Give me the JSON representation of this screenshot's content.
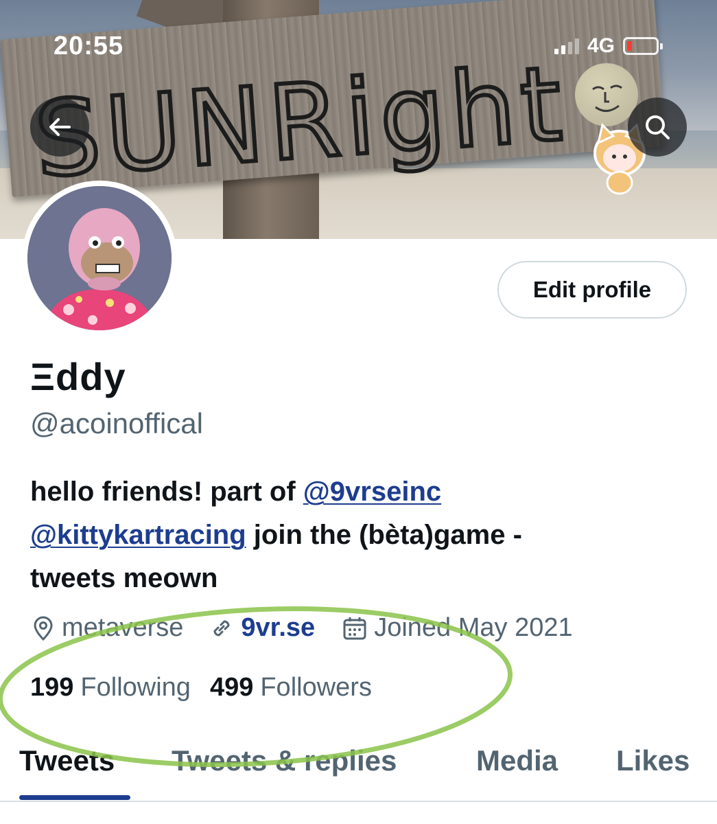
{
  "status_bar": {
    "time": "20:55",
    "network": "4G",
    "battery_color": "#ff3b30"
  },
  "banner": {
    "sign_text": "SUNRight"
  },
  "header": {
    "back_icon": "arrow-left-icon",
    "search_icon": "search-icon"
  },
  "profile": {
    "edit_label": "Edit profile",
    "name": "Ξddy",
    "handle": "@acoinoffical",
    "bio": {
      "line1_text": "hello friends! part of ",
      "mention1": "@9vrseinc",
      "mention2": "@kittykartracing",
      "line2_text": " join the (bèta)game -",
      "line3_text": "tweets meown"
    },
    "location": "metaverse",
    "website": "9vr.se",
    "joined": "Joined May 2021",
    "following_count": "199",
    "following_label": "Following",
    "followers_count": "499",
    "followers_label": "Followers"
  },
  "tabs": [
    {
      "label": "Tweets",
      "active": true
    },
    {
      "label": "Tweets & replies",
      "active": false
    },
    {
      "label": "Media",
      "active": false
    },
    {
      "label": "Likes",
      "active": false
    }
  ],
  "colors": {
    "link": "#1d3d8f",
    "secondary_text": "#536471",
    "highlight_ellipse": "#8bc34a"
  }
}
